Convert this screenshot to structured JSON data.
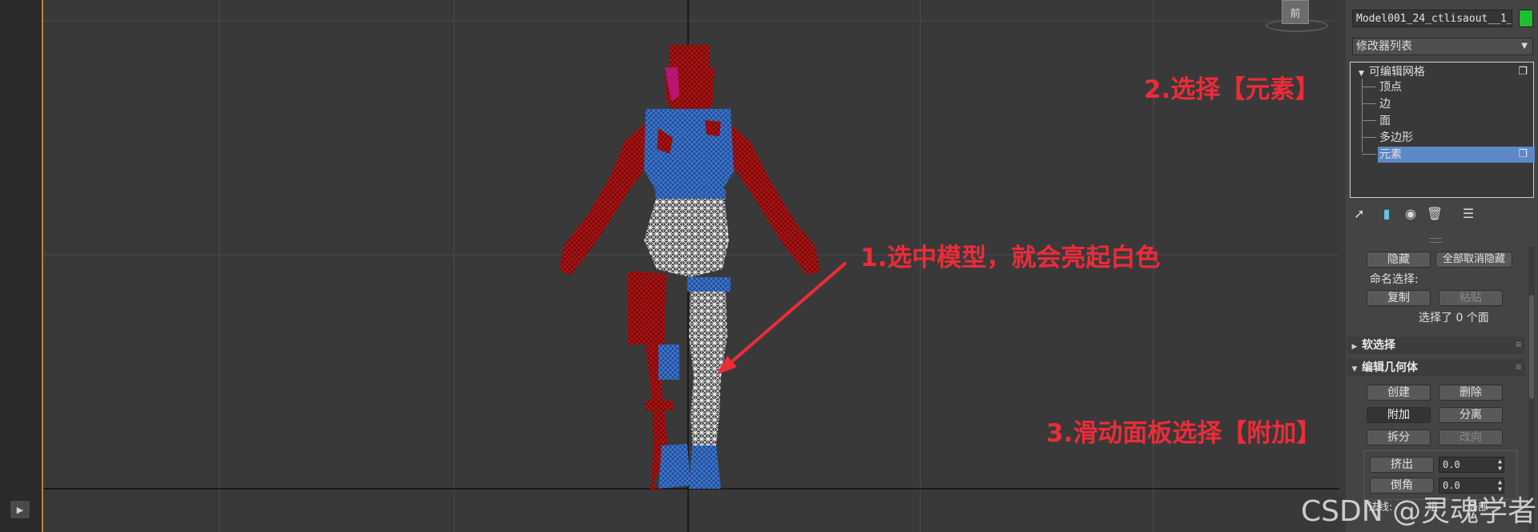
{
  "viewport": {
    "viewcube_label": "前",
    "play_icon": "play-icon"
  },
  "annotations": {
    "step1": "1.选中模型，就会亮起白色",
    "step2": "2.选择【元素】",
    "step3": "3.滑动面板选择【附加】",
    "arrow_color": "#ec2c38"
  },
  "watermark": "CSDN @灵魂学者",
  "panel": {
    "object_name": "Model001_24_ctlisaout__1_",
    "object_color": "#1fbf2d",
    "modifier_list": "修改器列表",
    "stack": {
      "root": "可编辑网格",
      "items": [
        "顶点",
        "边",
        "面",
        "多边形",
        "元素"
      ],
      "selected": "元素",
      "selected_color": "#5d88c8"
    },
    "toolbar_icons": [
      "pin-icon",
      "show-end-result-icon",
      "make-unique-icon",
      "remove-modifier-icon",
      "configure-modifier-sets-icon"
    ],
    "selection": {
      "hide": "隐藏",
      "unhide_all": "全部取消隐藏",
      "named_selections": "命名选择:",
      "copy": "复制",
      "paste": "粘贴",
      "status": "选择了 0 个面"
    },
    "soft_selection": {
      "title": "软选择"
    },
    "edit_geometry": {
      "title": "编辑几何体",
      "create": "创建",
      "delete": "删除",
      "attach": "附加",
      "detach": "分离",
      "divide": "拆分",
      "turn": "改向",
      "extrude": "挤出",
      "extrude_value": "0.0",
      "chamfer": "倒角",
      "chamfer_value": "0.0",
      "normal_label": "法线:",
      "group_label": "组",
      "local_label": "局部"
    }
  }
}
